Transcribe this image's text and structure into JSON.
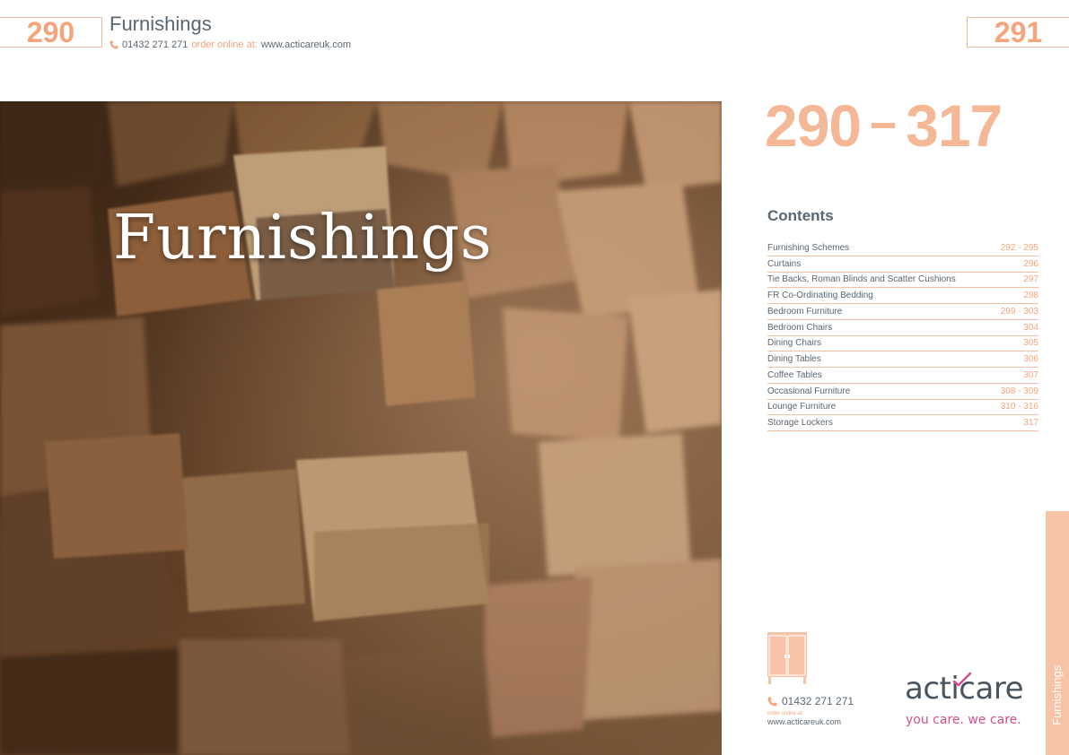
{
  "header": {
    "left_page_number": "290",
    "right_page_number": "291",
    "section_title": "Furnishings",
    "phone": "01432 271 271",
    "order_online_label": "order online at:",
    "website": "www.acticareuk.com"
  },
  "hero": {
    "title": "Furnishings"
  },
  "range": {
    "start": "290",
    "end": "317"
  },
  "contents": {
    "heading": "Contents",
    "items": [
      {
        "label": "Furnishing Schemes",
        "pages": "292 - 295"
      },
      {
        "label": "Curtains",
        "pages": "296"
      },
      {
        "label": "Tie Backs, Roman Blinds and Scatter Cushions",
        "pages": "297"
      },
      {
        "label": "FR Co-Ordinating Bedding",
        "pages": "298"
      },
      {
        "label": "Bedroom Furniture",
        "pages": "299 - 303"
      },
      {
        "label": "Bedroom Chairs",
        "pages": "304"
      },
      {
        "label": "Dining Chairs",
        "pages": "305"
      },
      {
        "label": "Dining Tables",
        "pages": "306"
      },
      {
        "label": "Coffee Tables",
        "pages": "307"
      },
      {
        "label": "Occasional Furniture",
        "pages": "308 - 309"
      },
      {
        "label": "Lounge Furniture",
        "pages": "310 - 316"
      },
      {
        "label": "Storage Lockers",
        "pages": "317"
      }
    ]
  },
  "side_tab": {
    "label": "Furnishings"
  },
  "footer": {
    "phone": "01432 271 271",
    "order_online_label": "order online at:",
    "website": "www.acticareuk.com",
    "brand": "acticare",
    "tagline": "you care. we care."
  },
  "colors": {
    "accent": "#f5a47c",
    "range": "#f5b896",
    "text": "#5a6670",
    "tagline": "#d44f8f"
  },
  "icons": [
    "phone-icon",
    "wardrobe-icon"
  ]
}
